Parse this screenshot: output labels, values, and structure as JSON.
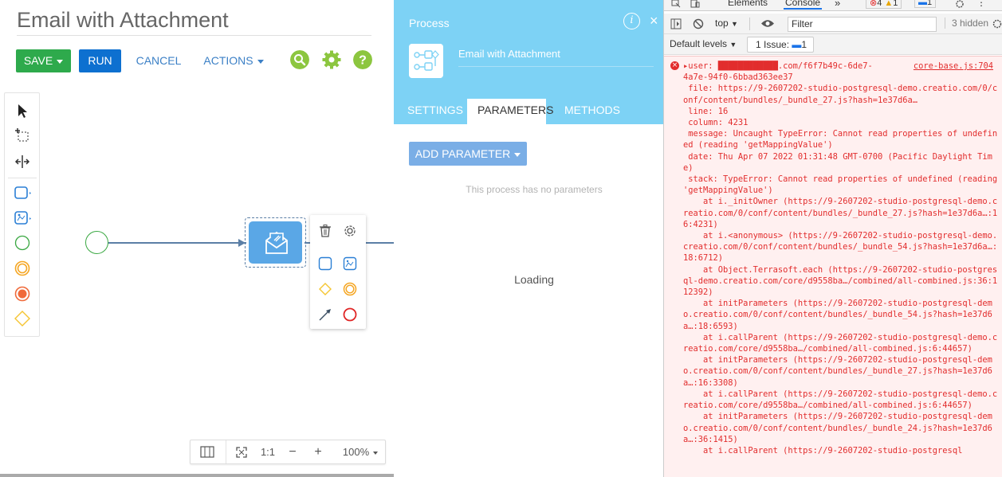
{
  "designer": {
    "title": "Email with Attachment",
    "buttons": {
      "save": "SAVE",
      "run": "RUN",
      "cancel": "CANCEL",
      "actions": "ACTIONS"
    },
    "zoom": {
      "ratio": "1:1",
      "percent": "100%"
    },
    "colors": {
      "save": "#2eaa4c",
      "run": "#0d70d0",
      "link": "#3c80c6",
      "green_icon": "#8cc63f",
      "task": "#5aa7e6"
    }
  },
  "process": {
    "header": "Process",
    "name": "Email with Attachment",
    "tabs": [
      "SETTINGS",
      "PARAMETERS",
      "METHODS"
    ],
    "add_parameter": "ADD PARAMETER",
    "empty_text": "This process has no parameters",
    "loading": "Loading"
  },
  "devtools": {
    "tabs": {
      "elements": "Elements",
      "console": "Console"
    },
    "badges": {
      "errors": "4",
      "warnings": "1",
      "info": "1"
    },
    "context": "top",
    "filter_placeholder": "Filter",
    "hidden": "3 hidden",
    "levels": "Default levels",
    "issues": "1 Issue:",
    "issues_count": "1",
    "source_link": "core-base.js:704",
    "console_lines": [
      "▸user: ████████████.com/f6f7b49c-6de7-",
      "4a7e-94f0-6bbad363ee37",
      " file: https://9-2607202-studio-postgresql-demo.creatio.com/0/conf/content/bundles/_bundle_27.js?hash=1e37d6a…",
      " line: 16",
      " column: 4231",
      " message: Uncaught TypeError: Cannot read properties of undefined (reading 'getMappingValue')",
      " date: Thu Apr 07 2022 01:31:48 GMT-0700 (Pacific Daylight Time)",
      " stack: TypeError: Cannot read properties of undefined (reading 'getMappingValue')",
      "    at i._initOwner (https://9-2607202-studio-postgresql-demo.creatio.com/0/conf/content/bundles/_bundle_27.js?hash=1e37d6a…:16:4231)",
      "    at i.<anonymous> (https://9-2607202-studio-postgresql-demo.creatio.com/0/conf/content/bundles/_bundle_54.js?hash=1e37d6a…:18:6712)",
      "    at Object.Terrasoft.each (https://9-2607202-studio-postgresql-demo.creatio.com/core/d9558ba…/combined/all-combined.js:36:112392)",
      "    at initParameters (https://9-2607202-studio-postgresql-demo.creatio.com/0/conf/content/bundles/_bundle_54.js?hash=1e37d6a…:18:6593)",
      "    at i.callParent (https://9-2607202-studio-postgresql-demo.creatio.com/core/d9558ba…/combined/all-combined.js:6:44657)",
      "    at initParameters (https://9-2607202-studio-postgresql-demo.creatio.com/0/conf/content/bundles/_bundle_27.js?hash=1e37d6a…:16:3308)",
      "    at i.callParent (https://9-2607202-studio-postgresql-demo.creatio.com/core/d9558ba…/combined/all-combined.js:6:44657)",
      "    at initParameters (https://9-2607202-studio-postgresql-demo.creatio.com/0/conf/content/bundles/_bundle_24.js?hash=1e37d6a…:36:1415)",
      "    at i.callParent (https://9-2607202-studio-postgresql"
    ]
  }
}
